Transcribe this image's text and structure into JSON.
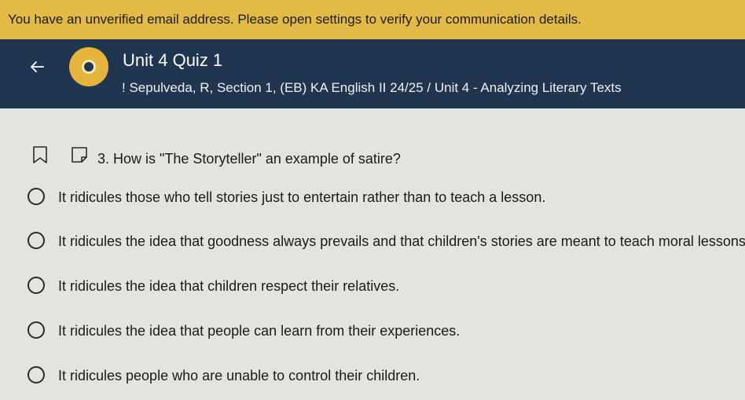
{
  "banner": {
    "text": "You have an unverified email address. Please open settings to verify your communication details."
  },
  "header": {
    "back_icon": "arrow-left-icon",
    "logo_icon": "course-logo-icon",
    "title": "Unit 4 Quiz 1",
    "subtitle": "! Sepulveda, R, Section 1, (EB) KA English II 24/25 / Unit 4 - Analyzing Literary Texts"
  },
  "question": {
    "bookmark_icon": "bookmark-icon",
    "note_icon": "note-icon",
    "text": "3. How is \"The Storyteller\" an example of satire?"
  },
  "choices": [
    {
      "label": "It ridicules those who tell stories just to entertain rather than to teach a lesson."
    },
    {
      "label": "It ridicules the idea that goodness always prevails and that children's stories are meant to teach moral lessons."
    },
    {
      "label": "It ridicules the idea that children respect their relatives."
    },
    {
      "label": "It ridicules the idea that people can learn from their experiences."
    },
    {
      "label": "It ridicules people who are unable to control their children."
    }
  ],
  "colors": {
    "banner": "#e2ba45",
    "header": "#1f3550",
    "background": "#e3e3df"
  }
}
